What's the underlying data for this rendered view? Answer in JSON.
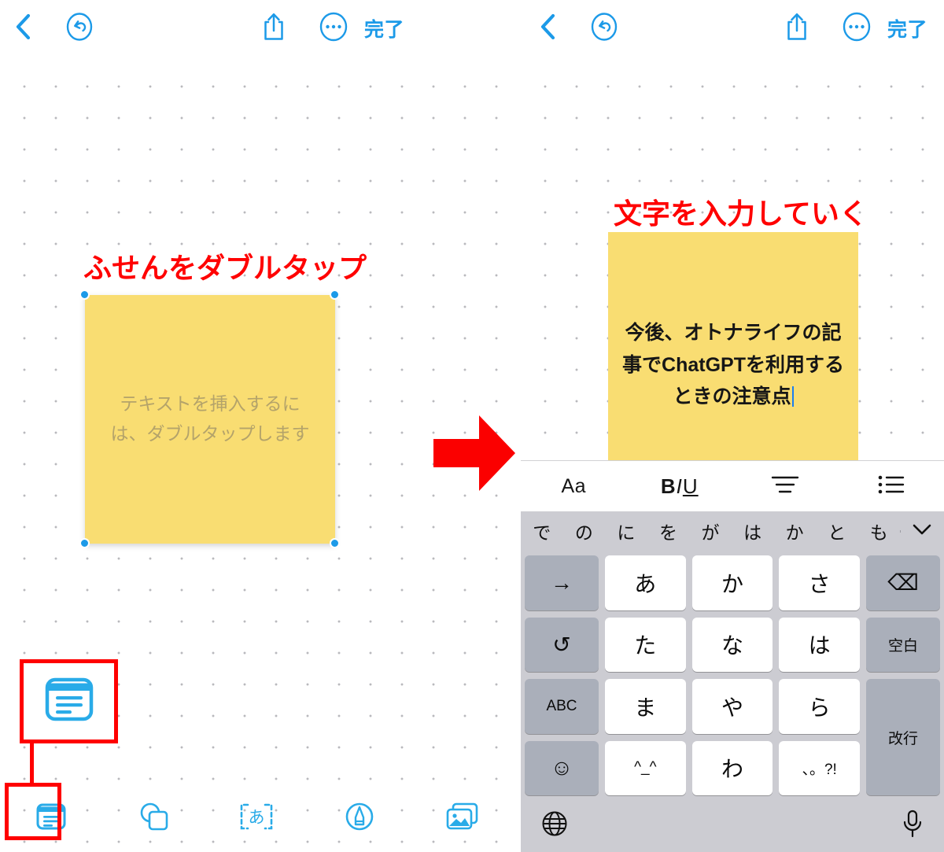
{
  "app": {
    "header": {
      "back_icon": "chevron-left-icon",
      "undo_icon": "undo-circle-icon",
      "share_icon": "share-icon",
      "more_icon": "more-ellipsis-icon",
      "done_label": "完了"
    },
    "accent_color": "#1c9ae8",
    "annotation_color": "#ff0000",
    "sticky_color": "#f9dd72"
  },
  "left_panel": {
    "annotation": "ふせんをダブルタップ",
    "sticky_note": {
      "placeholder": "テキストを挿入するには、ダブルタップします",
      "selected": true,
      "handles": 4
    },
    "zoom_callout": {
      "icon": "sticky-note-icon"
    },
    "toolbar": {
      "items": [
        {
          "icon": "sticky-note-icon",
          "selected": true
        },
        {
          "icon": "shapes-icon",
          "selected": false
        },
        {
          "icon": "text-box-icon",
          "label": "あ",
          "selected": false
        },
        {
          "icon": "pen-icon",
          "selected": false
        },
        {
          "icon": "media-icon",
          "selected": false
        }
      ]
    }
  },
  "transition": {
    "arrow_icon": "right-arrow-icon"
  },
  "right_panel": {
    "annotation": "文字を入力していく",
    "sticky_note": {
      "text": "今後、オトナライフの記事でChatGPTを利用するときの注意点",
      "has_caret": true
    },
    "format_bar": {
      "items": [
        {
          "name": "font-style-button",
          "label": "Aa"
        },
        {
          "name": "bold-italic-underline-button",
          "bold": "B",
          "italic": "I",
          "underline": "U"
        },
        {
          "name": "align-button",
          "icon": "align-center-icon"
        },
        {
          "name": "list-button",
          "icon": "bullet-list-icon"
        }
      ]
    },
    "keyboard": {
      "predictions": [
        "で",
        "の",
        "に",
        "を",
        "が",
        "は",
        "か",
        "と",
        "も"
      ],
      "collapse_icon": "chevron-down-icon",
      "rows": [
        [
          {
            "label": "→",
            "style": "dark",
            "name": "key-next-candidate"
          },
          {
            "label": "あ",
            "style": "light",
            "name": "key-a"
          },
          {
            "label": "か",
            "style": "light",
            "name": "key-ka"
          },
          {
            "label": "さ",
            "style": "light",
            "name": "key-sa"
          },
          {
            "label": "⌫",
            "style": "dark",
            "name": "key-backspace"
          }
        ],
        [
          {
            "label": "↺",
            "style": "dark",
            "name": "key-undo"
          },
          {
            "label": "た",
            "style": "light",
            "name": "key-ta"
          },
          {
            "label": "な",
            "style": "light",
            "name": "key-na"
          },
          {
            "label": "は",
            "style": "light",
            "name": "key-ha"
          },
          {
            "label": "空白",
            "style": "dark",
            "name": "key-space"
          }
        ],
        [
          {
            "label": "ABC",
            "style": "dark",
            "name": "key-abc"
          },
          {
            "label": "ま",
            "style": "light",
            "name": "key-ma"
          },
          {
            "label": "や",
            "style": "light",
            "name": "key-ya"
          },
          {
            "label": "ら",
            "style": "light",
            "name": "key-ra"
          },
          {
            "label": "改行",
            "style": "dark",
            "name": "key-return"
          }
        ],
        [
          {
            "label": "☺",
            "style": "dark",
            "name": "key-emoji"
          },
          {
            "label": "^_^",
            "style": "light",
            "name": "key-kaomoji"
          },
          {
            "label": "わ",
            "style": "light",
            "name": "key-wa"
          },
          {
            "label": "、。?!",
            "style": "light",
            "name": "key-punctuation"
          }
        ]
      ],
      "bottom": {
        "globe_icon": "globe-icon",
        "mic_icon": "microphone-icon"
      }
    }
  }
}
